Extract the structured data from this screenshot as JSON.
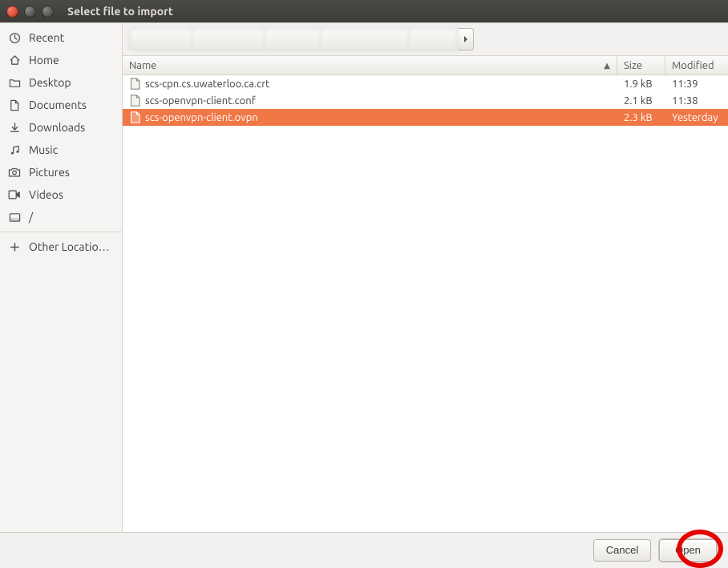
{
  "window": {
    "title": "Select file to import"
  },
  "sidebar": {
    "primary": [
      {
        "id": "recent",
        "label": "Recent",
        "icon": "clock-icon"
      },
      {
        "id": "home",
        "label": "Home",
        "icon": "home-icon"
      },
      {
        "id": "desktop",
        "label": "Desktop",
        "icon": "folder-icon"
      },
      {
        "id": "documents",
        "label": "Documents",
        "icon": "document-icon"
      },
      {
        "id": "downloads",
        "label": "Downloads",
        "icon": "download-icon"
      },
      {
        "id": "music",
        "label": "Music",
        "icon": "music-icon"
      },
      {
        "id": "pictures",
        "label": "Pictures",
        "icon": "camera-icon"
      },
      {
        "id": "videos",
        "label": "Videos",
        "icon": "video-icon"
      },
      {
        "id": "root",
        "label": "/",
        "icon": "drive-icon"
      }
    ],
    "secondary": [
      {
        "id": "other",
        "label": "Other Locatio…",
        "icon": "plus-icon"
      }
    ]
  },
  "columns": {
    "name": "Name",
    "size": "Size",
    "modified": "Modified"
  },
  "files": [
    {
      "name": "scs-cpn.cs.uwaterloo.ca.crt",
      "size": "1.9 kB",
      "modified": "11:39",
      "selected": false
    },
    {
      "name": "scs-openvpn-client.conf",
      "size": "2.1 kB",
      "modified": "11:38",
      "selected": false
    },
    {
      "name": "scs-openvpn-client.ovpn",
      "size": "2.3 kB",
      "modified": "Yesterday",
      "selected": true
    }
  ],
  "buttons": {
    "cancel": "Cancel",
    "open": "Open"
  },
  "colors": {
    "selection": "#f07746",
    "highlight_ring": "#e60000"
  }
}
